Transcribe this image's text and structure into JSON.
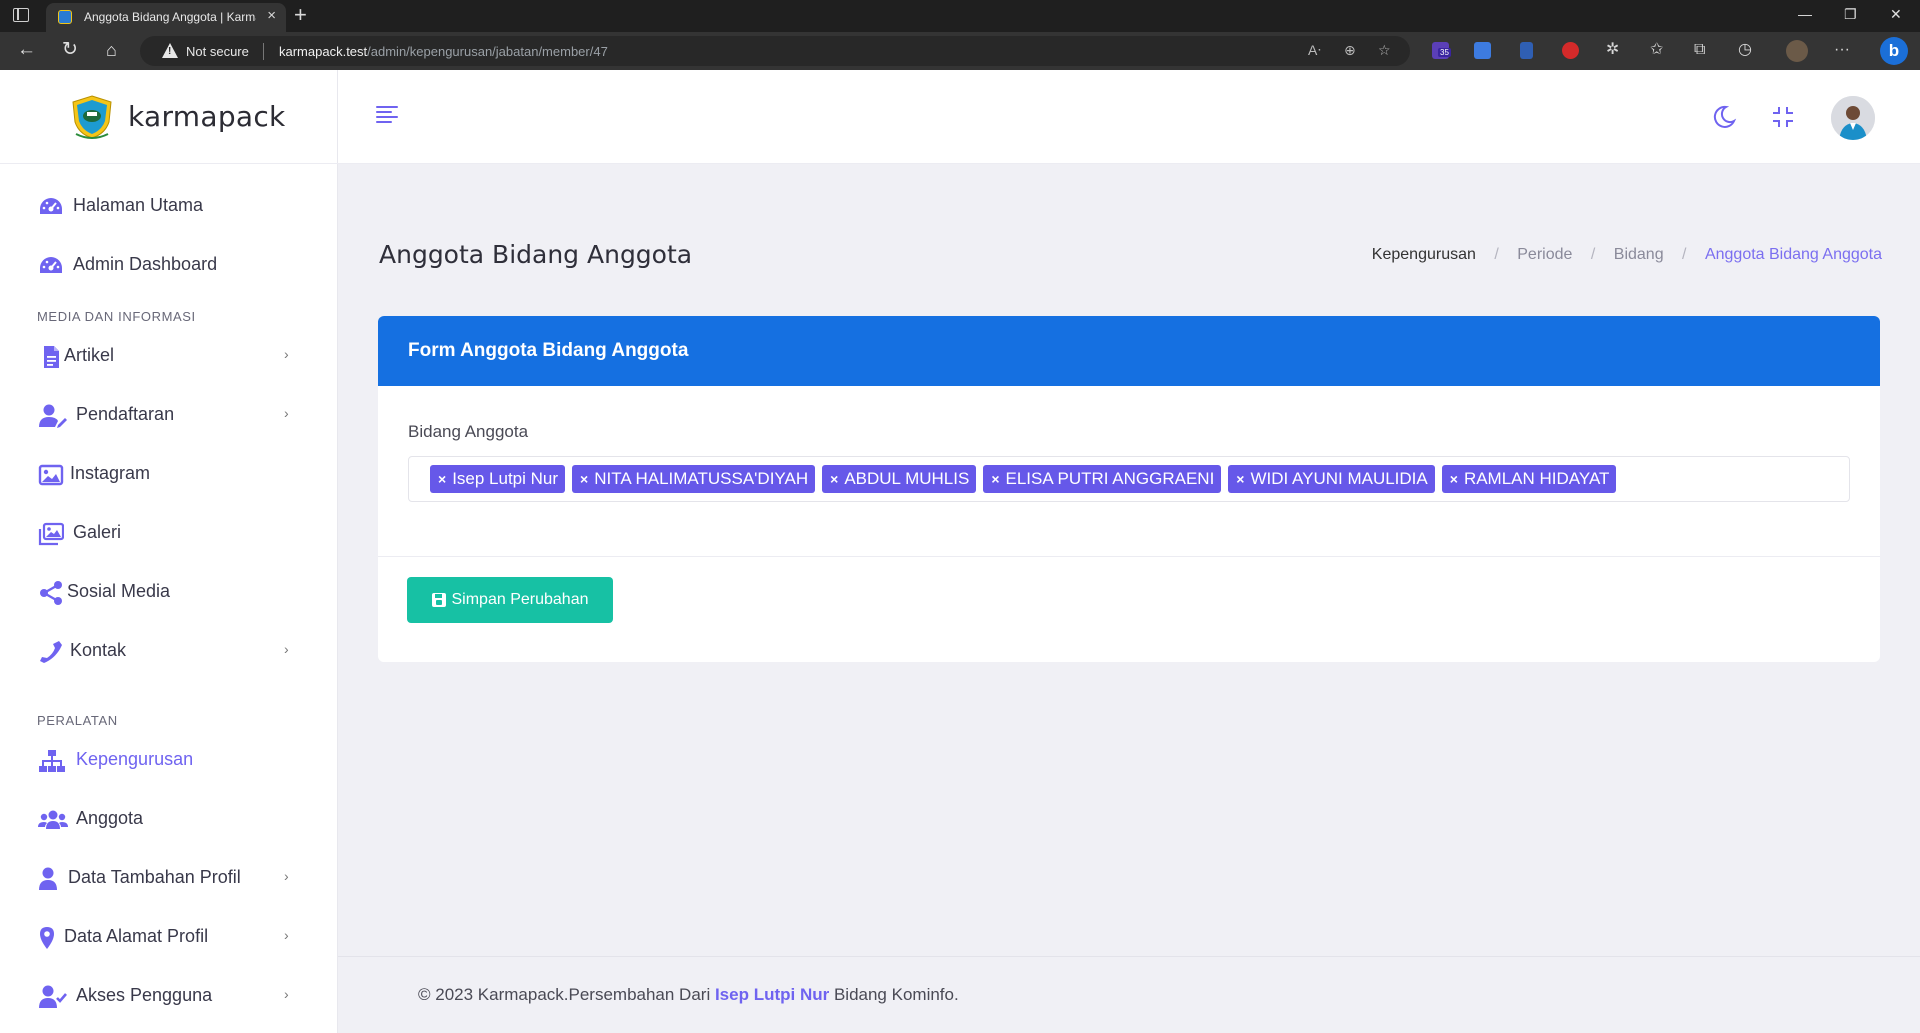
{
  "browser": {
    "tab_title": "Anggota Bidang Anggota | Karmapack",
    "security_label": "Not secure",
    "url_host": "karmapack.test",
    "url_path": "/admin/kepengurusan/jabatan/member/47",
    "extension_badge": "35",
    "bing_label": "b"
  },
  "app": {
    "brand_name": "karmapack"
  },
  "sidebar": {
    "items_top": [
      {
        "label": "Halaman Utama",
        "icon": "dashboard-icon"
      },
      {
        "label": "Admin Dashboard",
        "icon": "dashboard-icon"
      }
    ],
    "section_media": "MEDIA DAN INFORMASI",
    "items_media": [
      {
        "label": "Artikel",
        "icon": "file-icon",
        "has_submenu": true
      },
      {
        "label": "Pendaftaran",
        "icon": "user-edit-icon",
        "has_submenu": true
      },
      {
        "label": "Instagram",
        "icon": "image-icon",
        "has_submenu": false
      },
      {
        "label": "Galeri",
        "icon": "images-icon",
        "has_submenu": false
      },
      {
        "label": "Sosial Media",
        "icon": "share-icon",
        "has_submenu": false
      },
      {
        "label": "Kontak",
        "icon": "phone-icon",
        "has_submenu": true
      }
    ],
    "section_tools": "PERALATAN",
    "items_tools": [
      {
        "label": "Kepengurusan",
        "icon": "sitemap-icon",
        "has_submenu": false,
        "active": true
      },
      {
        "label": "Anggota",
        "icon": "users-icon",
        "has_submenu": false
      },
      {
        "label": "Data Tambahan Profil",
        "icon": "user-icon",
        "has_submenu": true
      },
      {
        "label": "Data Alamat Profil",
        "icon": "map-marker-icon",
        "has_submenu": true
      },
      {
        "label": "Akses Pengguna",
        "icon": "user-check-icon",
        "has_submenu": true
      }
    ]
  },
  "page": {
    "title": "Anggota Bidang Anggota",
    "breadcrumb": [
      "Kepengurusan",
      "Periode",
      "Bidang",
      "Anggota Bidang Anggota"
    ]
  },
  "form": {
    "header": "Form Anggota Bidang Anggota",
    "field_label": "Bidang Anggota",
    "selected_tags": [
      "Isep Lutpi Nur",
      "NITA HALIMATUSSA'DIYAH",
      "ABDUL MUHLIS",
      "ELISA PUTRI ANGGRAENI",
      "WIDI AYUNI MAULIDIA",
      "RAMLAN HIDAYAT"
    ],
    "tag_remove_glyph": "×",
    "submit_label": "Simpan Perubahan"
  },
  "footer": {
    "prefix": "© 2023 Karmapack.Persembahan Dari ",
    "author": "Isep Lutpi Nur",
    "suffix": " Bidang Kominfo."
  },
  "colors": {
    "primary": "#6f63f0",
    "card_header": "#1570e1",
    "tag": "#6658e9",
    "success": "#17c1a4"
  }
}
